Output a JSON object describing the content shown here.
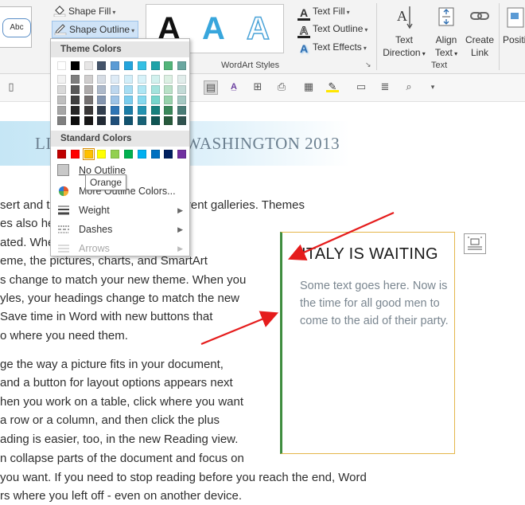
{
  "ribbon": {
    "style_preview": "Abc",
    "shape_fill": "Shape Fill",
    "shape_outline": "Shape Outline",
    "wordart_letter": "A",
    "wordart_group": "WordArt Styles",
    "text_fill": "Text Fill",
    "text_outline": "Text Outline",
    "text_effects": "Text Effects",
    "text_direction": [
      "Text",
      "Direction"
    ],
    "align_text": [
      "Align",
      "Text"
    ],
    "create_link": [
      "Create",
      "Link"
    ],
    "text_group": "Text",
    "position_partial": "Positi"
  },
  "dropdown": {
    "theme_header": "Theme Colors",
    "standard_header": "Standard Colors",
    "theme_top_row": [
      "#ffffff",
      "#000000",
      "#e7e6e6",
      "#44546a",
      "#5b9bd5",
      "#24a4dc",
      "#35c0e4",
      "#1fa3a8",
      "#53b57a",
      "#6aa7a0"
    ],
    "theme_columns": [
      [
        "#f2f2f2",
        "#d9d9d9",
        "#bfbfbf",
        "#a6a6a6",
        "#7f7f7f"
      ],
      [
        "#7f7f7f",
        "#595959",
        "#404040",
        "#262626",
        "#0d0d0d"
      ],
      [
        "#d0cece",
        "#aeabab",
        "#757171",
        "#3a3838",
        "#171616"
      ],
      [
        "#d6dce4",
        "#adb9ca",
        "#8496b0",
        "#323f4f",
        "#222a35"
      ],
      [
        "#deebf6",
        "#bdd7ee",
        "#9dc3e6",
        "#2e75b5",
        "#1f4e79"
      ],
      [
        "#d2eef9",
        "#a6ddf3",
        "#79cced",
        "#1a7ca6",
        "#11526e"
      ],
      [
        "#d7f2f9",
        "#aee6f4",
        "#86d9ef",
        "#2393b1",
        "#186276"
      ],
      [
        "#d1f1ee",
        "#a3e3dd",
        "#76d5cc",
        "#16807d",
        "#0f5553"
      ],
      [
        "#dcf0e3",
        "#b9e1c7",
        "#97d2ab",
        "#3a885a",
        "#275a3c"
      ],
      [
        "#e1edeb",
        "#c3dbd7",
        "#a5c9c3",
        "#4a7d77",
        "#31534f"
      ]
    ],
    "standard_colors": [
      "#c00000",
      "#ff0000",
      "#ffc000",
      "#ffff00",
      "#92d050",
      "#00b050",
      "#00b0f0",
      "#0070c0",
      "#002060",
      "#7030a0"
    ],
    "no_outline": "No Outline",
    "more_colors": "More Outline Colors...",
    "weight": "Weight",
    "dashes": "Dashes",
    "arrows": "Arrows",
    "tooltip": "Orange"
  },
  "document": {
    "title_left": "LI",
    "title_right": "WASHINGTON 2013",
    "lines": [
      "sert and th                  t you want from the different galleries. Themes",
      "es also he",
      "ated. Whe                    choose a",
      "eme, the pictures, charts, and SmartArt",
      "s change to match your new theme. When you",
      "yles, your headings change to match the new",
      "Save time in Word with new buttons that",
      "o where you need them.",
      "ge the way a picture fits in your document,",
      "and a button for layout options appears next",
      "hen you work on a table, click where you want",
      "a row or a column, and then click the plus",
      "ading is easier, too, in the new Reading view.",
      "n collapse parts of the document and focus on",
      " you want. If you need to stop reading before you reach the end, Word",
      "rs where you left off - even on another device."
    ],
    "textbox_title": "ITALY IS WAITING",
    "textbox_body": "Some text goes here. Now is the time for all good men to come to the aid of their party."
  }
}
